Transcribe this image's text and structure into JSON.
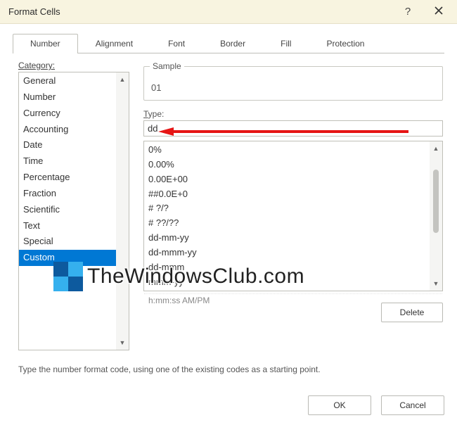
{
  "title": "Format Cells",
  "tabs": [
    {
      "label": "Number",
      "active": true
    },
    {
      "label": "Alignment"
    },
    {
      "label": "Font"
    },
    {
      "label": "Border"
    },
    {
      "label": "Fill"
    },
    {
      "label": "Protection"
    }
  ],
  "category_label": "Category:",
  "categories": [
    "General",
    "Number",
    "Currency",
    "Accounting",
    "Date",
    "Time",
    "Percentage",
    "Fraction",
    "Scientific",
    "Text",
    "Special",
    "Custom"
  ],
  "category_selected": "Custom",
  "sample_label": "Sample",
  "sample_value": "01",
  "type_label": "Type:",
  "type_value": "dd",
  "formats": [
    "0%",
    "0.00%",
    "0.00E+00",
    "##0.0E+0",
    "# ?/?",
    "# ??/??",
    "dd-mm-yy",
    "dd-mmm-yy",
    "dd-mmm",
    "mmm-yy"
  ],
  "formats_truncated": "h:mm:ss AM/PM",
  "delete_label": "Delete",
  "help_text": "Type the number format code, using one of the existing codes as a starting point.",
  "ok_label": "OK",
  "cancel_label": "Cancel",
  "watermark": "TheWindowsClub.com"
}
